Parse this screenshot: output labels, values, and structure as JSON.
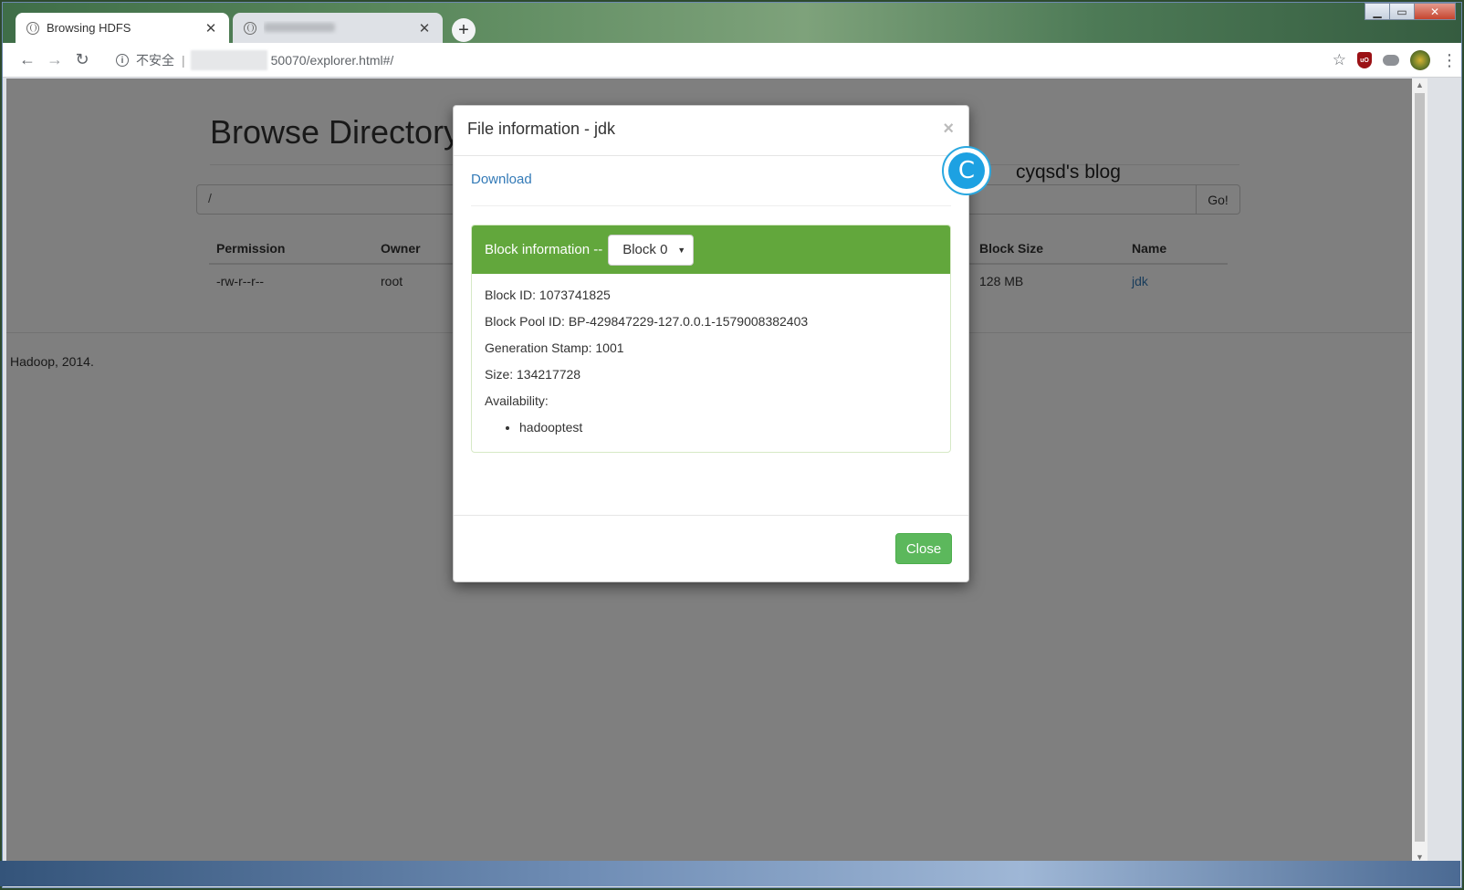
{
  "browser": {
    "tabs": [
      {
        "title": "Browsing HDFS",
        "active": true
      },
      {
        "title": "",
        "active": false
      }
    ],
    "omnibox": {
      "security_label": "不安全",
      "url": "50070/explorer.html#/"
    },
    "icons": [
      "back-icon",
      "forward-icon",
      "reload-icon",
      "info-icon",
      "star-icon",
      "ublock-icon",
      "cloud-icon",
      "avatar",
      "menu-icon"
    ]
  },
  "page": {
    "heading": "Browse Directory",
    "path_value": "/",
    "go_label": "Go!",
    "table": {
      "columns": [
        "Permission",
        "Owner",
        "Block Size",
        "Name"
      ],
      "rows": [
        {
          "permission": "-rw-r--r--",
          "owner": "root",
          "block_size": "128 MB",
          "name": "jdk"
        }
      ]
    },
    "footer": "Hadoop, 2014."
  },
  "modal": {
    "title": "File information - jdk",
    "close_x": "×",
    "download_label": "Download",
    "block_info_label": "Block information --",
    "selected_block": "Block 0",
    "details": {
      "block_id": "Block ID: 1073741825",
      "block_pool_id": "Block Pool ID: BP-429847229-127.0.0.1-1579008382403",
      "generation_stamp": "Generation Stamp: 1001",
      "size": "Size: 134217728",
      "availability_label": "Availability:",
      "availability_hosts": [
        "hadooptest"
      ]
    },
    "close_label": "Close"
  },
  "watermark": {
    "text": "cyqsd's blog"
  },
  "colors": {
    "panel_green": "#62a73c",
    "close_green": "#5cb85c",
    "link_blue": "#337ab7"
  }
}
